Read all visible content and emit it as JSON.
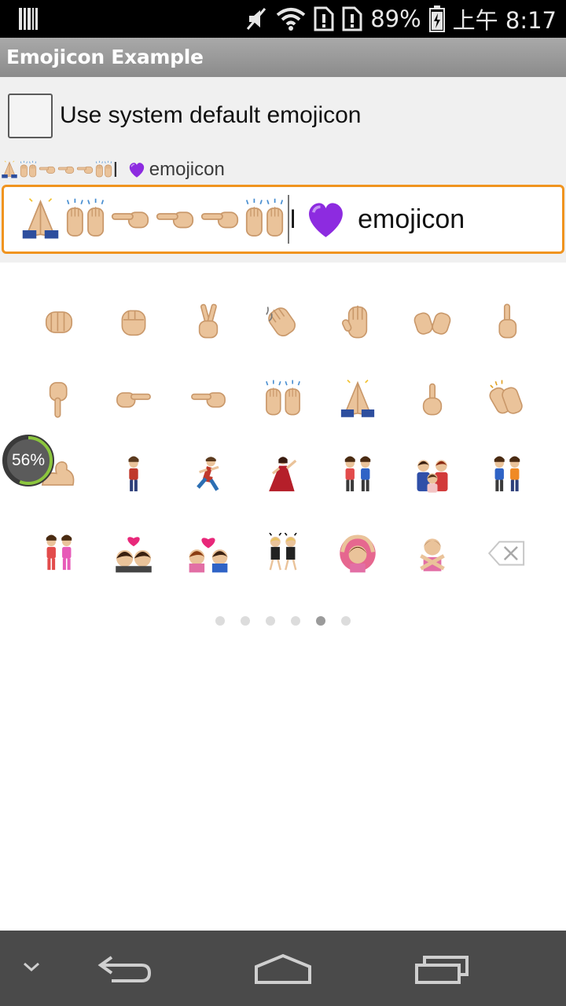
{
  "status_bar": {
    "battery_percent": "89%",
    "time": "上午 8:17",
    "icons": [
      "barcode-icon",
      "muted-icon",
      "wifi-icon",
      "sim-alert-icon",
      "sim-alert-icon",
      "battery-charging-icon"
    ]
  },
  "action_bar": {
    "title": "Emojicon Example"
  },
  "checkbox": {
    "label": "Use system default emojicon",
    "checked": false
  },
  "preview": {
    "emojis": [
      "pray",
      "raised-hands",
      "point-left",
      "point-left",
      "point-left",
      "raised-hands"
    ],
    "cursor_char": "l",
    "heart": "purple-heart",
    "text": "emojicon"
  },
  "edit_box": {
    "emojis": [
      "pray",
      "raised-hands",
      "point-left",
      "point-left",
      "point-left",
      "raised-hands"
    ],
    "cursor_char": "l",
    "heart": "purple-heart",
    "text": "emojicon",
    "focus_color": "#f0941f"
  },
  "emoji_grid": {
    "rows": [
      [
        "punch",
        "fist",
        "victory-hand",
        "waving-hand",
        "raised-hand",
        "open-hands",
        "point-up"
      ],
      [
        "point-down",
        "point-right",
        "point-left",
        "raised-hands",
        "pray",
        "point-up-2",
        "clap"
      ],
      [
        "muscle",
        "walking",
        "runner",
        "dancer",
        "couple",
        "family",
        "two-men"
      ],
      [
        "two-women",
        "couple-kiss",
        "couple-heart",
        "dancers",
        "ok-woman",
        "no-good-woman",
        "backspace-icon"
      ]
    ]
  },
  "pager": {
    "count": 6,
    "active_index": 4
  },
  "battery_badge": {
    "text": "56%",
    "level": 0.56
  },
  "nav_bar": {
    "buttons": [
      "hide-keyboard-icon",
      "back-icon",
      "home-icon",
      "recents-icon"
    ]
  },
  "colors": {
    "skin": "#eac39a",
    "skin_shade": "#c9986a",
    "accent_orange": "#f0941f",
    "purple": "#8d2be0"
  }
}
